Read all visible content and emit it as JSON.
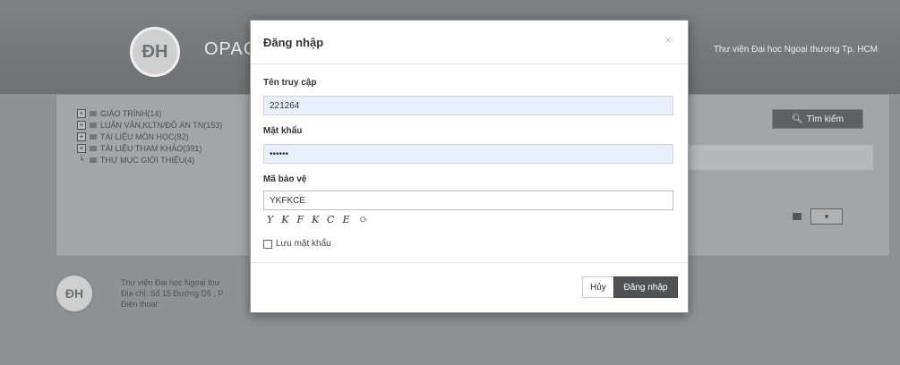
{
  "background": {
    "brand": "OPAC",
    "logo": "ĐH",
    "university": "Thư viện Đại học Ngoại thương Tp. HCM",
    "search_button": "Tìm kiếm",
    "tree": [
      {
        "label": "GIÁO TRÌNH(14)"
      },
      {
        "label": "LUẬN VĂN,KLTN/ĐỒ ÁN TN(153)"
      },
      {
        "label": "TÀI LIỆU MÔN HỌC(82)"
      },
      {
        "label": "TÀI LIỆU THAM KHẢO(391)"
      },
      {
        "label": "THƯ MỤC GIỚI THIỆU(4)"
      }
    ],
    "footer": {
      "name": "Thư viện Đại học Ngoại thư",
      "address": "Địa chỉ: Số 15 Đường D5 , P",
      "phone": "Điện thoại:"
    }
  },
  "modal": {
    "title": "Đăng nhập",
    "close": "×",
    "username_label": "Tên truy cập",
    "username_value": "221264",
    "password_label": "Mật khẩu",
    "password_value": "••••••",
    "captcha_label": "Mã bảo vệ",
    "captcha_value": "YKFKCE",
    "captcha_image_text": "YKFKCE",
    "remember_label": "Lưu mật khẩu",
    "cancel_label": "Hủy",
    "login_label": "Đăng nhập"
  }
}
